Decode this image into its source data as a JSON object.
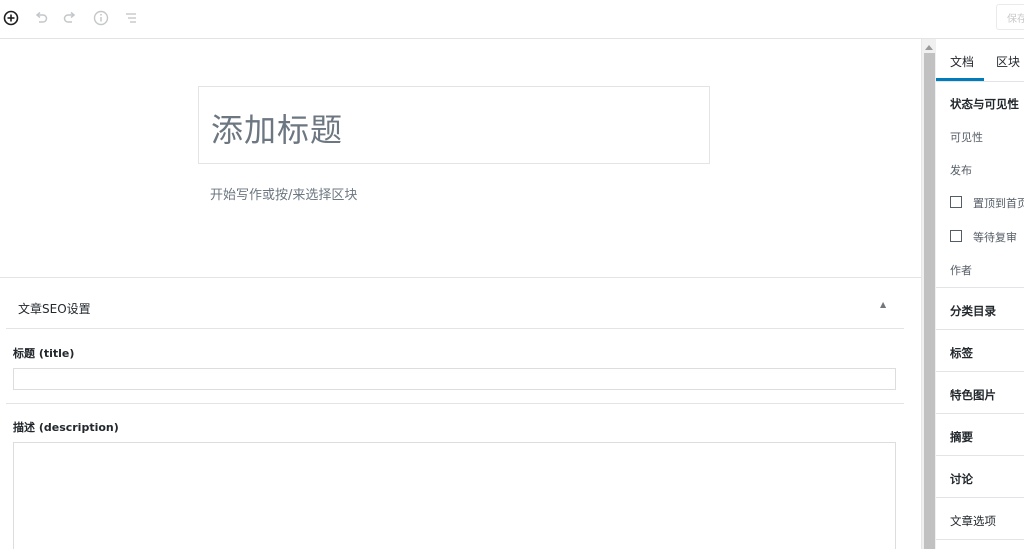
{
  "toolbar": {
    "icons": [
      "add-block-icon",
      "undo-icon",
      "redo-icon",
      "info-icon",
      "outline-icon"
    ],
    "save_label": "保存草稿"
  },
  "editor": {
    "title_placeholder": "添加标题",
    "start_writing": "开始写作或按/来选择区块"
  },
  "seo_panel": {
    "title": "文章SEO设置",
    "toggle": "▲",
    "title_label": "标题 (title)",
    "title_value": "",
    "description_label": "描述 (description)",
    "description_value": ""
  },
  "sidebar": {
    "tabs": [
      {
        "label": "文档",
        "active": true
      },
      {
        "label": "区块",
        "active": false
      }
    ],
    "status": {
      "title": "状态与可见性",
      "visibility_label": "可见性",
      "publish_label": "发布",
      "stick_to_top_label": "置顶到首页",
      "pending_review_label": "等待复审",
      "author_label": "作者"
    },
    "sections": [
      "分类目录",
      "标签",
      "特色图片",
      "摘要",
      "讨论",
      "文章选项"
    ]
  },
  "colors": {
    "accent": "#007cba",
    "border": "#e2e4e7",
    "muted_text": "#6c7781"
  }
}
